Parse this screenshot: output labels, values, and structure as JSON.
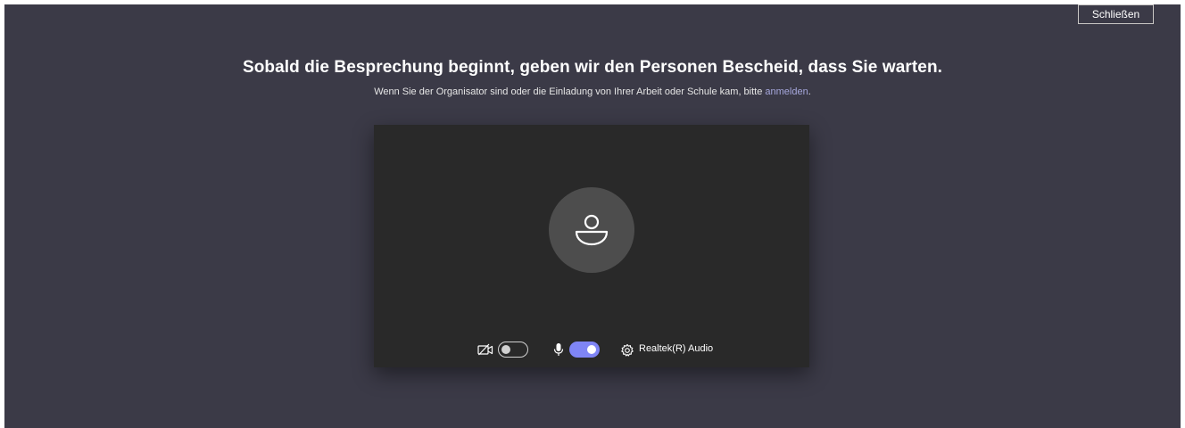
{
  "window": {
    "close_label": "Schließen"
  },
  "lobby": {
    "headline": "Sobald die Besprechung beginnt, geben wir den Personen Bescheid, dass Sie warten.",
    "subline_prefix": "Wenn Sie der Organisator sind oder die Einladung von Ihrer Arbeit oder Schule kam, bitte ",
    "signin_link": "anmelden",
    "subline_suffix": "."
  },
  "preview": {
    "avatar_icon": "person-icon",
    "controls": {
      "camera": {
        "icon": "camera-off-icon",
        "enabled": false
      },
      "microphone": {
        "icon": "microphone-icon",
        "enabled": true
      },
      "device_settings": {
        "icon": "gear-icon",
        "label": "Realtek(R) Audio"
      }
    }
  },
  "colors": {
    "background": "#3b3a47",
    "preview_background": "#292929",
    "avatar_background": "#4d4d4d",
    "accent": "#7f85f5",
    "link": "#a6a7dc"
  }
}
